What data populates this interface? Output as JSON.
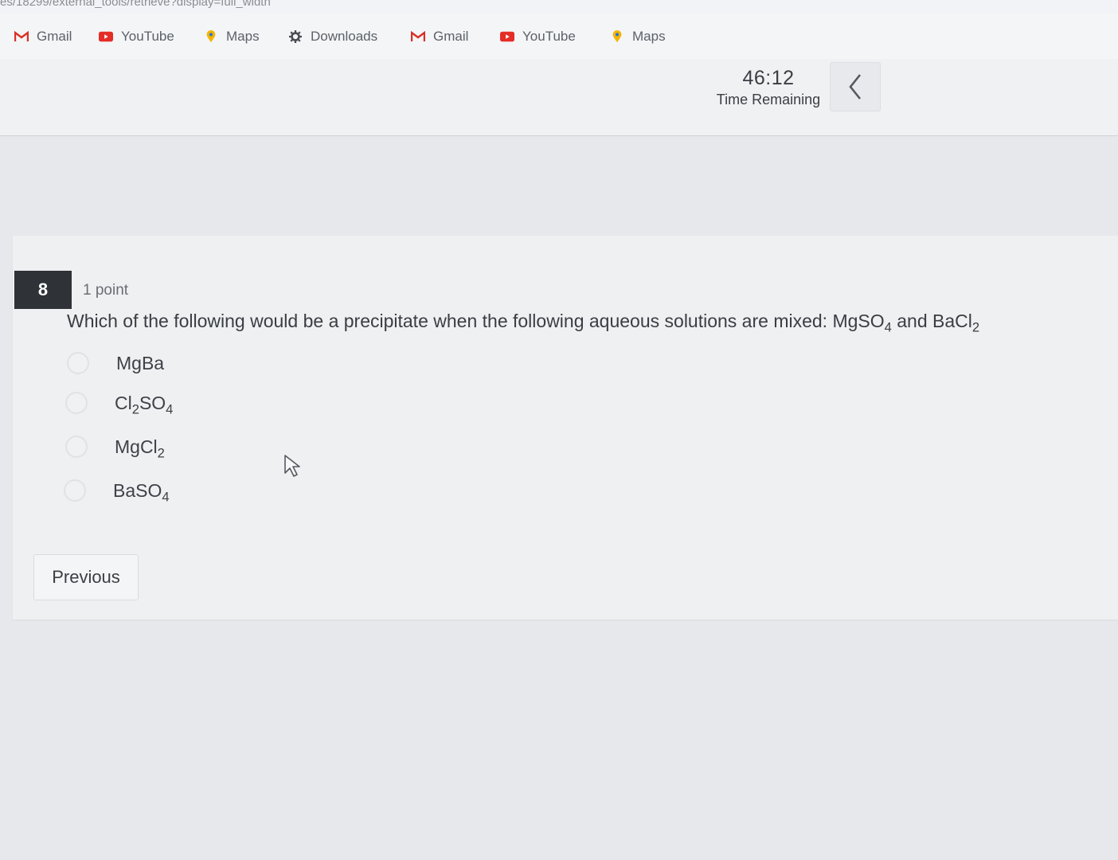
{
  "browser": {
    "url_fragment": "es/18299/external_tools/retrieve?display=full_width",
    "bookmarks": [
      {
        "label": "Gmail",
        "icon": "gmail-icon"
      },
      {
        "label": "YouTube",
        "icon": "youtube-icon"
      },
      {
        "label": "Maps",
        "icon": "maps-pin-icon"
      },
      {
        "label": "Downloads",
        "icon": "gear-icon"
      },
      {
        "label": "Gmail",
        "icon": "gmail-icon"
      },
      {
        "label": "YouTube",
        "icon": "youtube-icon"
      },
      {
        "label": "Maps",
        "icon": "maps-pin-icon"
      }
    ]
  },
  "timer": {
    "value": "46:12",
    "label": "Time Remaining",
    "collapse_icon": "chevron-left-icon"
  },
  "question": {
    "number": "8",
    "points": "1 point",
    "text_main": "Which of the following would be a precipitate when the following aqueous solutions are mixed: MgSO",
    "text_sub1": "4",
    "text_mid": " and BaCl",
    "text_sub2": "2",
    "options": [
      {
        "parts": [
          "MgBa"
        ]
      },
      {
        "parts": [
          "Cl",
          "2",
          "SO",
          "4"
        ]
      },
      {
        "parts": [
          "MgCl",
          "2"
        ]
      },
      {
        "parts": [
          "BaSO",
          "4"
        ]
      }
    ]
  },
  "navigation": {
    "previous_label": "Previous"
  },
  "colors": {
    "gmail_red": "#d93025",
    "youtube_red": "#e52d27",
    "maps_yellow": "#f4b400",
    "badge_bg": "#2f3236"
  }
}
